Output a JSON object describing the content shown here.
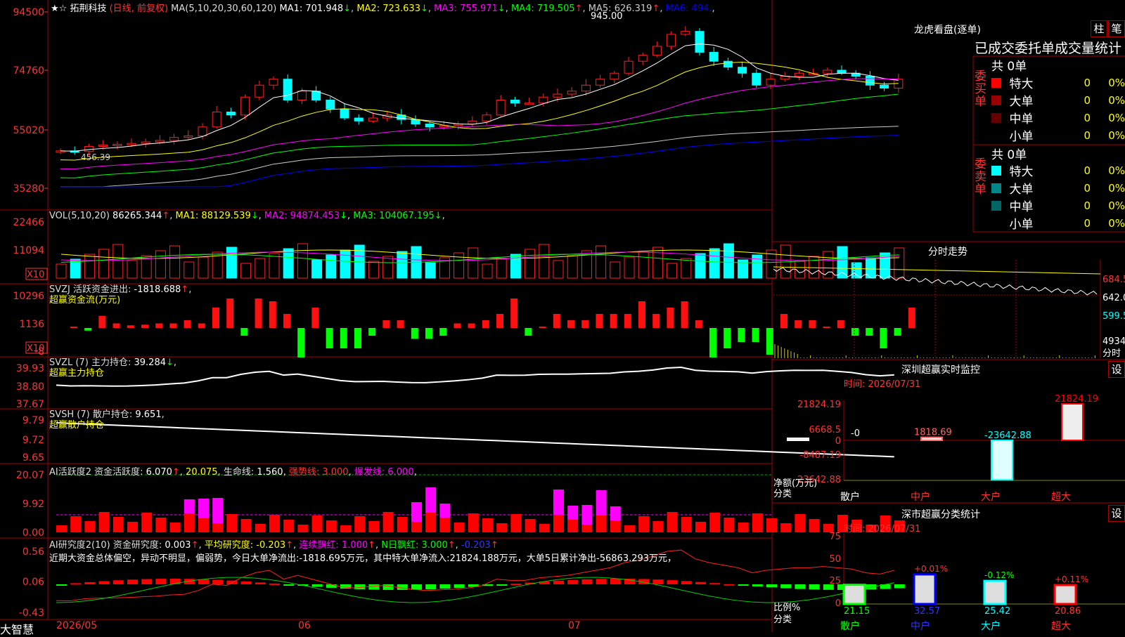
{
  "stock": {
    "name": "拓荆科技",
    "mode": "(日线, 前复权)",
    "ma_params": "MA(5,10,20,30,60,120)",
    "ma_items": [
      {
        "label": "MA1:",
        "value": "701.948",
        "arrow": "↓",
        "color": "#ffffff"
      },
      {
        "label": "MA2:",
        "value": "723.633",
        "arrow": "↓",
        "color": "#ffff00"
      },
      {
        "label": "MA3:",
        "value": "755.971",
        "arrow": "↓",
        "color": "#ff00ff"
      },
      {
        "label": "MA4:",
        "value": "719.505",
        "arrow": "↑",
        "color": "#00ff00"
      },
      {
        "label": "MA5:",
        "value": "626.319",
        "arrow": "↑",
        "color": "#cccccc"
      },
      {
        "label": "MA6:",
        "value": "494.",
        "arrow": "",
        "color": "#0000ff"
      }
    ],
    "price_ticks": [
      "94500",
      "74760",
      "55020",
      "35280"
    ],
    "high_label": "945.00",
    "low_label": "456.39",
    "closes": [
      480,
      478,
      495,
      500,
      502,
      505,
      510,
      515,
      525,
      530,
      560,
      610,
      600,
      660,
      700,
      720,
      650,
      680,
      650,
      620,
      590,
      580,
      590,
      600,
      585,
      570,
      560,
      565,
      570,
      580,
      600,
      650,
      640,
      640,
      660,
      670,
      680,
      700,
      720,
      740,
      780,
      800,
      830,
      870,
      880,
      810,
      780,
      760,
      740,
      700,
      720,
      730,
      740,
      740,
      750,
      740,
      730,
      700,
      690,
      720
    ]
  },
  "vol": {
    "title": "VOL(5,10,20)",
    "value": "86265.344",
    "items": [
      {
        "label": "MA1:",
        "value": "88129.539",
        "arrow": "↓",
        "color": "#ffff00"
      },
      {
        "label": "MA2:",
        "value": "94874.453",
        "arrow": "↓",
        "color": "#ff00ff"
      },
      {
        "label": "MA3:",
        "value": "104067.195",
        "arrow": "↓",
        "color": "#00ff00"
      }
    ],
    "ticks": [
      "22466",
      "11094"
    ],
    "unit": "X10"
  },
  "svzj": {
    "title": "SVZJ  活跃资金进出:",
    "value": "-1818.688",
    "subtitle": "超赢资金流(万元)",
    "ticks": [
      "10296",
      "1136",
      "-8"
    ],
    "unit": "X10"
  },
  "svzl": {
    "title": "SVZL (7) 主力持仓:",
    "value": "39.284",
    "subtitle": "超赢主力持仓",
    "ticks": [
      "39.93",
      "38.80",
      "37.67"
    ]
  },
  "svsh": {
    "title": "SVSH (7) 散户持仓:",
    "value": "9.651",
    "subtitle": "超赢散户持仓",
    "ticks": [
      "9.79",
      "9.72",
      "9.65"
    ]
  },
  "ai_active": {
    "title": "AI活跃度2 资金活跃度:",
    "value": "6.070",
    "v2": "20.075",
    "life_label": "生命线:",
    "life": "1.560",
    "strong_label": "强势线:",
    "strong": "3.000",
    "burst_label": "爆发线:",
    "burst": "6.000",
    "ticks": [
      "20.07",
      "9.92",
      "0.00"
    ]
  },
  "ai_research": {
    "title": "AI研究度2(10) 资金研究度:",
    "value": "0.003",
    "avg_label": "平均研究度:",
    "avg": "-0.203",
    "red_label": "连续飘红:",
    "red": "1.000",
    "nred_label": "N日飘红:",
    "nred": "3.000",
    "last": "-0.203",
    "summary": "近期大资金总体偏空，异动不明显，偏弱势，今日大单净流出:-1818.695万元，其中特大单净流入:21824.188万元，大单5日累计净出-56863.293万元，",
    "ticks": [
      "0.56",
      "0.06",
      "-0.43"
    ]
  },
  "dates": [
    "2026/05",
    "06",
    "07"
  ],
  "brand": "大智慧",
  "right": {
    "lhkp_title": "龙虎看盘(逐单)",
    "btn_zhu": "柱",
    "btn_bi": "笔",
    "tabs": "已成交委托单成交量统计",
    "buy_label": "委买单",
    "sell_label": "委卖单",
    "buy_total": "共 0单",
    "sell_total": "共 0单",
    "buy_rows": [
      {
        "name": "特大",
        "count": "0",
        "pct": "0%",
        "color": "#ff0000"
      },
      {
        "name": "大单",
        "count": "0",
        "pct": "0%",
        "color": "#990000"
      },
      {
        "name": "中单",
        "count": "0",
        "pct": "0%",
        "color": "#660000"
      },
      {
        "name": "小单",
        "count": "0",
        "pct": "0%",
        "color": ""
      }
    ],
    "sell_rows": [
      {
        "name": "特大",
        "count": "0",
        "pct": "0%",
        "color": "#00ffff"
      },
      {
        "name": "大单",
        "count": "0",
        "pct": "0%",
        "color": "#008888"
      },
      {
        "name": "中单",
        "count": "0",
        "pct": "0%",
        "color": "#006666"
      },
      {
        "name": "小单",
        "count": "0",
        "pct": "0%",
        "color": ""
      }
    ],
    "fs_title": "分时走势",
    "fs_ticks": [
      "684.5",
      "642.0",
      "599.5"
    ],
    "fs_vol": "4934",
    "fs_vol_unit": "分时",
    "sz_title": "深圳超赢实时监控",
    "set_label": "设",
    "time_label": "时间: 2026/07/31",
    "sz_ticks": [
      "21824.19",
      "6668.5",
      "0",
      "-8487.19",
      "-23642.88"
    ],
    "sz_values": [
      {
        "name": "散户",
        "value": 0,
        "label": "-0",
        "color": "#ffffff"
      },
      {
        "name": "中户",
        "value": 1818.69,
        "label": "1818.69",
        "color": "#ff6666"
      },
      {
        "name": "大户",
        "value": -23642.88,
        "label": "-23642.88",
        "color": "#00ffff"
      },
      {
        "name": "超大",
        "value": 21824.19,
        "label": "21824.19",
        "color": "#ff0000"
      }
    ],
    "net_label": "净额(万元)",
    "class_label": "分类",
    "sc_title": "深市超赢分类统计",
    "sc_ticks": [
      "75",
      "50",
      "25",
      "0"
    ],
    "sc_values": [
      {
        "name": "散户",
        "value": 21.15,
        "label": "21.15",
        "delta": "",
        "color": "#00ff00"
      },
      {
        "name": "中户",
        "value": 32.57,
        "label": "32.57",
        "delta": "+0.01%",
        "color": "#0000ff"
      },
      {
        "name": "大户",
        "value": 25.42,
        "label": "25.42",
        "delta": "-0.12%",
        "color": "#00ffff"
      },
      {
        "name": "超大",
        "value": 20.86,
        "label": "20.86",
        "delta": "+0.11%",
        "color": "#ff0000"
      }
    ],
    "ratio_label": "比例%"
  }
}
